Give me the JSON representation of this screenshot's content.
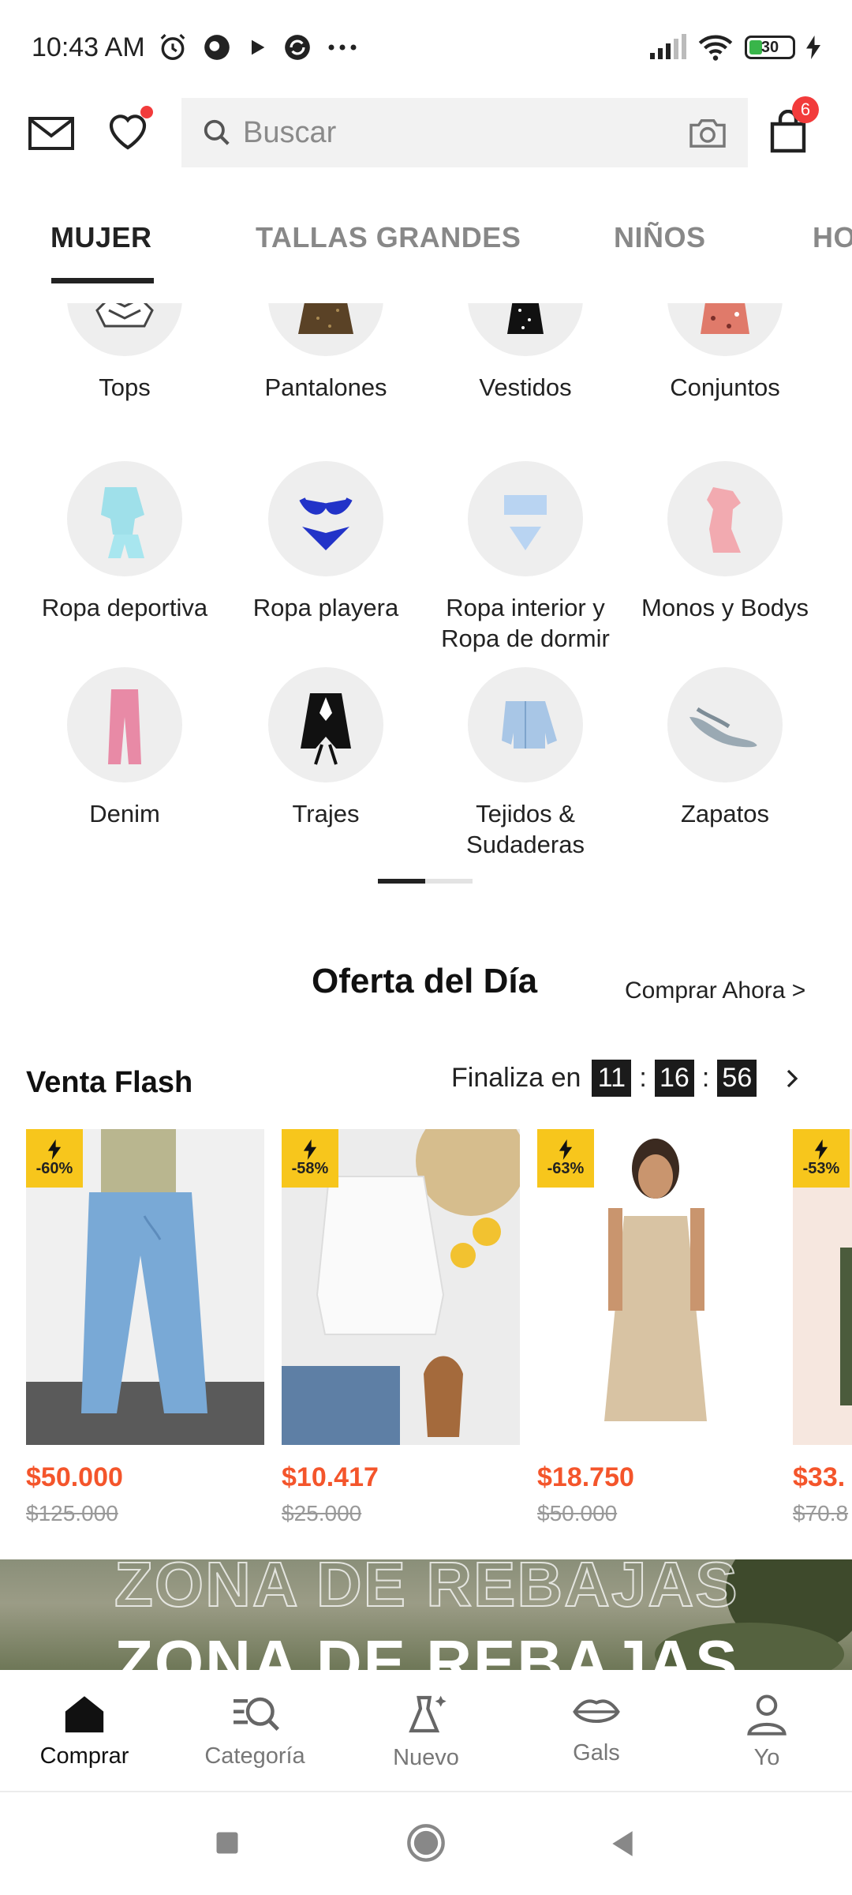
{
  "status_bar": {
    "time": "10:43 AM",
    "battery": "30"
  },
  "header": {
    "search_placeholder": "Buscar",
    "cart_count": "6"
  },
  "tabs": [
    {
      "label": "MUJER",
      "active": true
    },
    {
      "label": "TALLAS GRANDES",
      "active": false
    },
    {
      "label": "NIÑOS",
      "active": false
    },
    {
      "label": "HO",
      "active": false
    }
  ],
  "categories": [
    {
      "label": "Tops"
    },
    {
      "label": "Pantalones"
    },
    {
      "label": "Vestidos"
    },
    {
      "label": "Conjuntos"
    },
    {
      "label": "Ropa deportiva"
    },
    {
      "label": "Ropa playera"
    },
    {
      "label": "Ropa interior y Ropa de dormir"
    },
    {
      "label": "Monos y Bodys"
    },
    {
      "label": "Denim"
    },
    {
      "label": "Trajes"
    },
    {
      "label": "Tejidos & Sudaderas"
    },
    {
      "label": "Zapatos"
    }
  ],
  "oferta": {
    "title": "Oferta del Día",
    "link": "Comprar Ahora >"
  },
  "flash": {
    "title": "Venta Flash",
    "ends_label": "Finaliza en",
    "hours": "11",
    "minutes": "16",
    "seconds": "56"
  },
  "products": [
    {
      "discount": "-60%",
      "price": "$50.000",
      "old_price": "$125.000"
    },
    {
      "discount": "-58%",
      "price": "$10.417",
      "old_price": "$25.000"
    },
    {
      "discount": "-63%",
      "price": "$18.750",
      "old_price": "$50.000"
    },
    {
      "discount": "-53%",
      "price": "$33.",
      "old_price": "$70.8"
    }
  ],
  "banner": {
    "text": "ZONA DE REBAJAS"
  },
  "bottom_nav": [
    {
      "label": "Comprar",
      "icon": "home-icon",
      "active": true
    },
    {
      "label": "Categoría",
      "icon": "category-search-icon",
      "active": false
    },
    {
      "label": "Nuevo",
      "icon": "new-dress-icon",
      "active": false
    },
    {
      "label": "Gals",
      "icon": "lips-icon",
      "active": false
    },
    {
      "label": "Yo",
      "icon": "user-icon",
      "active": false
    }
  ],
  "colors": {
    "price": "#f4552b",
    "discount_badge": "#f7c61c",
    "notification": "#f23b3b"
  }
}
